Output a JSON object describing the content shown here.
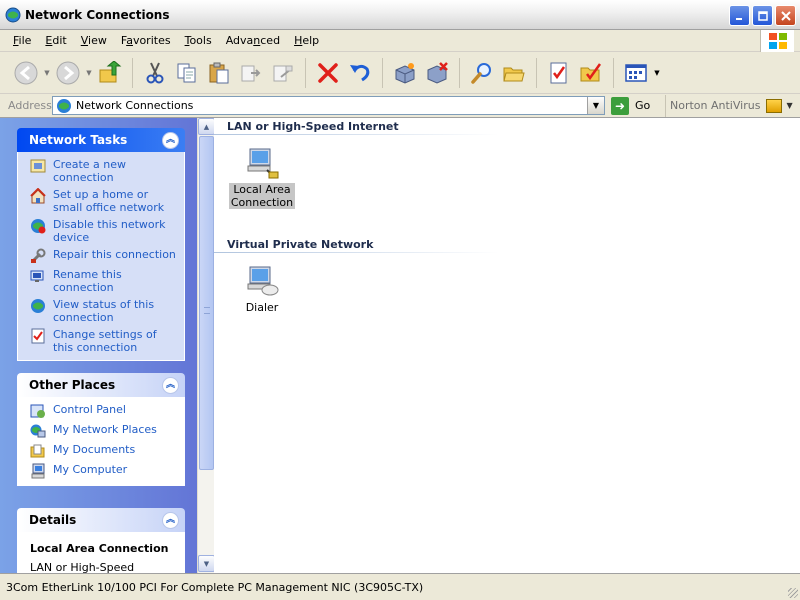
{
  "window": {
    "title": "Network Connections"
  },
  "menu": [
    {
      "label": "File",
      "accel": "F",
      "rest": "ile"
    },
    {
      "label": "Edit",
      "accel": "E",
      "rest": "dit"
    },
    {
      "label": "View",
      "accel": "V",
      "rest": "iew"
    },
    {
      "label": "Favorites",
      "accel": "",
      "pre": "F",
      "mid": "a",
      "post": "vorites"
    },
    {
      "label": "Tools",
      "accel": "T",
      "rest": "ools"
    },
    {
      "label": "Advanced",
      "accel": "",
      "pre": "Adva",
      "mid": "n",
      "post": "ced"
    },
    {
      "label": "Help",
      "accel": "H",
      "rest": "elp"
    }
  ],
  "toolbar": {
    "icons": [
      "back-icon",
      "forward-icon",
      "up-folder-icon",
      "cut-icon",
      "copy-icon",
      "paste-icon",
      "move-to-icon",
      "copy-to-icon",
      "delete-icon",
      "undo-icon",
      "properties-icon",
      "disconnect-icon",
      "search-icon",
      "folders-icon",
      "checklist-icon",
      "folder-options-icon",
      "views-icon"
    ]
  },
  "address": {
    "label": "Address",
    "value": "Network Connections",
    "go_label": "Go",
    "norton_label": "Norton AntiVirus"
  },
  "network_tasks": {
    "title": "Network Tasks",
    "items": [
      {
        "label": "Create a new connection",
        "icon": "new-connection-icon"
      },
      {
        "label": "Set up a home or small office network",
        "icon": "home-network-icon"
      },
      {
        "label": "Disable this network device",
        "icon": "disable-device-icon"
      },
      {
        "label": "Repair this connection",
        "icon": "repair-icon"
      },
      {
        "label": "Rename this connection",
        "icon": "rename-icon"
      },
      {
        "label": "View status of this connection",
        "icon": "status-icon"
      },
      {
        "label": "Change settings of this connection",
        "icon": "settings-icon"
      }
    ]
  },
  "other_places": {
    "title": "Other Places",
    "items": [
      {
        "label": "Control Panel",
        "icon": "control-panel-icon"
      },
      {
        "label": "My Network Places",
        "icon": "network-places-icon"
      },
      {
        "label": "My Documents",
        "icon": "documents-icon"
      },
      {
        "label": "My Computer",
        "icon": "computer-icon"
      }
    ]
  },
  "details": {
    "title": "Details",
    "name": "Local Area Connection",
    "line": "LAN or High-Speed Internet"
  },
  "groups": [
    {
      "title": "LAN or High-Speed Internet",
      "items": [
        {
          "label_line1": "Local Area",
          "label_line2": "Connection",
          "icon": "lan-connection-icon",
          "selected": true
        }
      ]
    },
    {
      "title": "Virtual Private Network",
      "items": [
        {
          "label_line1": "Dialer",
          "label_line2": "",
          "icon": "vpn-dialer-icon",
          "selected": false
        }
      ]
    }
  ],
  "status": {
    "text": "3Com EtherLink 10/100 PCI For Complete PC Management NIC (3C905C-TX)"
  },
  "colors": {
    "task_link": "#215dc6",
    "pane_gradient_start": "#7ba2e7",
    "pane_gradient_end": "#6375d6"
  }
}
